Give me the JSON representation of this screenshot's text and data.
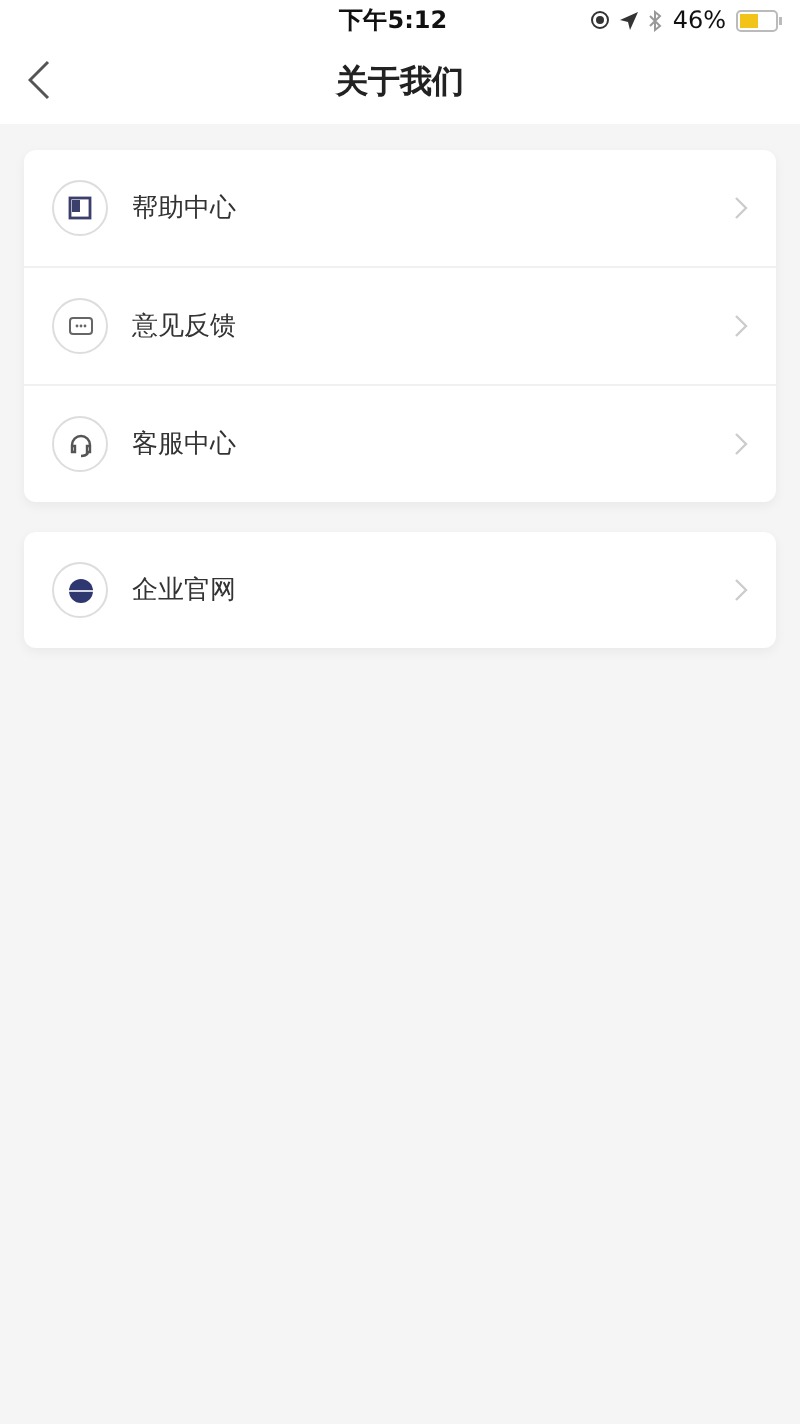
{
  "status_bar": {
    "time": "下午5:12",
    "battery": "46%"
  },
  "nav": {
    "title": "关于我们"
  },
  "groups": [
    {
      "items": [
        {
          "label": "帮助中心",
          "kind": "book"
        },
        {
          "label": "意见反馈",
          "kind": "chat"
        },
        {
          "label": "客服中心",
          "kind": "headset"
        }
      ]
    },
    {
      "items": [
        {
          "label": "企业官网",
          "kind": "globe"
        }
      ]
    }
  ]
}
